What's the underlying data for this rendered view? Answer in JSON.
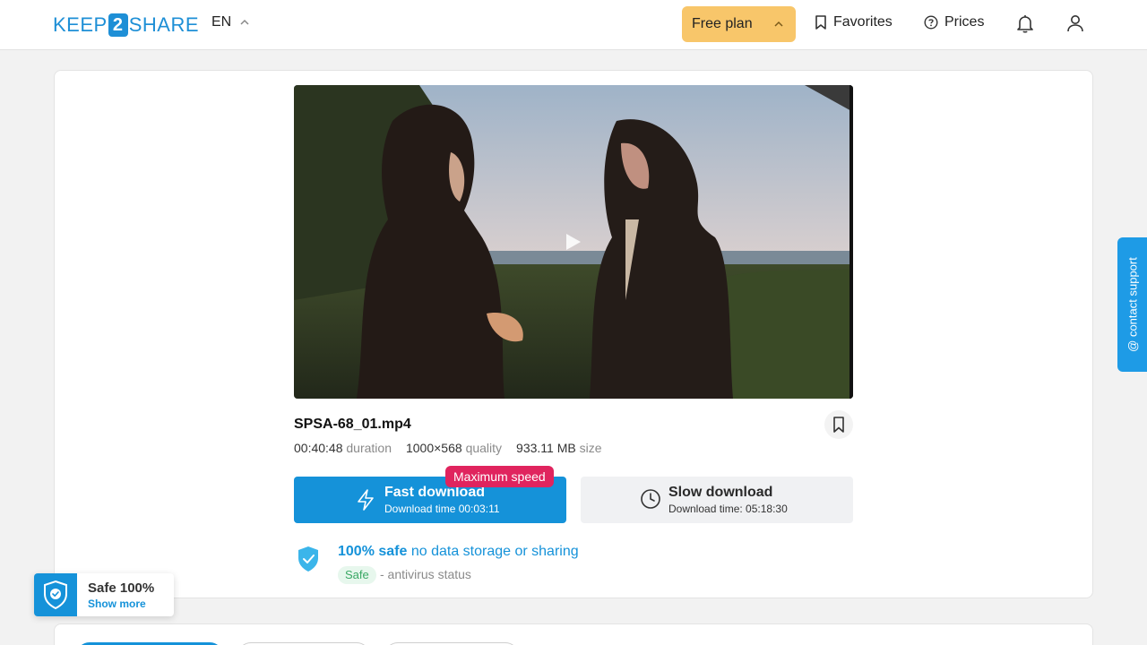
{
  "header": {
    "logo_left": "KEEP",
    "logo_mid": "2",
    "logo_right": "SHARE",
    "lang": "EN",
    "plan_label": "Free plan",
    "favorites_label": "Favorites",
    "prices_label": "Prices"
  },
  "file": {
    "name": "SPSA-68_01.mp4",
    "duration_value": "00:40:48",
    "duration_label": "duration",
    "quality_value": "1000×568",
    "quality_label": "quality",
    "size_value": "933.11 MB",
    "size_label": "size"
  },
  "download": {
    "fast_title": "Fast download",
    "fast_time": "Download time 00:03:11",
    "fast_badge": "Maximum speed",
    "slow_title": "Slow download",
    "slow_time": "Download time: 05:18:30"
  },
  "safety": {
    "headline_bold": "100% safe",
    "headline_rest": " no data storage or sharing",
    "tag": "Safe",
    "status_text": "- antivirus status"
  },
  "float_widget": {
    "title": "Safe 100%",
    "link": "Show more"
  },
  "contact_support": "@ contact support",
  "colors": {
    "brand_blue": "#1592d9",
    "plan_yellow": "#f8c66a",
    "badge_pink": "#e0245e"
  }
}
